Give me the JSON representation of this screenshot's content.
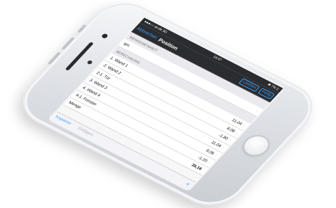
{
  "statusbar": {
    "carrier": "●●●○○ at-de 3G",
    "time": "14:37",
    "battery": "✱ 7% ▯"
  },
  "navbar": {
    "back_label": "Abbrechen",
    "title": "Position",
    "delete_label": "Löschen",
    "done_label": "Fertig"
  },
  "unit_section": {
    "header": "MENGENEINHEIT",
    "unit_value": "qm"
  },
  "calc_section": {
    "header": "BERECHNUNG",
    "rows": [
      {
        "label": "1. Wand 1",
        "value": "11,04"
      },
      {
        "label": "2. Wand 2",
        "value": "8,06"
      },
      {
        "label": "2-1. Tür",
        "value": "-1,80"
      },
      {
        "label": "3. Wand 3",
        "value": "11,04"
      },
      {
        "label": "4. Wand 4",
        "value": "8,06"
      },
      {
        "label": "4-1. Fenster",
        "value": "-1,20"
      },
      {
        "label": "Menge",
        "value": "35,18"
      }
    ]
  },
  "toolbar": {
    "copy_label": "Kopieren",
    "paste_label": "Einfügen",
    "add_label": "+"
  },
  "colors": {
    "accent": "#3ea1ff",
    "bar": "#2b2c2f"
  }
}
